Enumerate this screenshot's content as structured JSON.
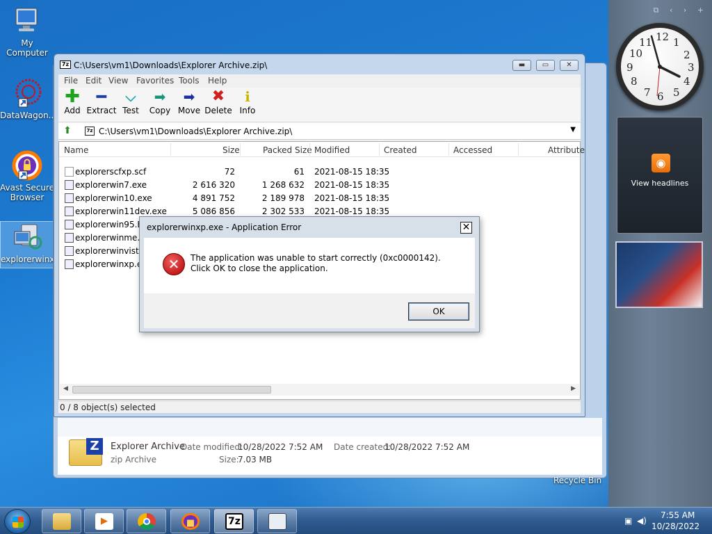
{
  "desktop": {
    "icons": [
      {
        "label": "My Computer"
      },
      {
        "label": "DataWagon..."
      },
      {
        "label": "Avast Secure Browser"
      },
      {
        "label": "explorerwinxp"
      }
    ],
    "recycle_bin": "Recycle Bin"
  },
  "sidebar": {
    "feed_label": "View headlines",
    "clock_numbers": [
      "12",
      "1",
      "2",
      "3",
      "4",
      "5",
      "6",
      "7",
      "8",
      "9",
      "10",
      "11"
    ]
  },
  "window": {
    "title": "C:\\Users\\vm1\\Downloads\\Explorer Archive.zip\\",
    "menu": [
      "File",
      "Edit",
      "View",
      "Favorites",
      "Tools",
      "Help"
    ],
    "toolbar": [
      {
        "label": "Add",
        "icon": "add-icon",
        "color": "#1ea31e"
      },
      {
        "label": "Extract",
        "icon": "extract-icon",
        "color": "#1c3ea8"
      },
      {
        "label": "Test",
        "icon": "test-icon",
        "color": "#17a8a8"
      },
      {
        "label": "Copy",
        "icon": "copy-icon",
        "color": "#15957b"
      },
      {
        "label": "Move",
        "icon": "move-icon",
        "color": "#1c2f98"
      },
      {
        "label": "Delete",
        "icon": "delete-icon",
        "color": "#d11f1f"
      },
      {
        "label": "Info",
        "icon": "info-icon",
        "color": "#c9b400"
      }
    ],
    "address": "C:\\Users\\vm1\\Downloads\\Explorer Archive.zip\\",
    "columns": [
      "Name",
      "Size",
      "Packed Size",
      "Modified",
      "Created",
      "Accessed",
      "Attribute"
    ],
    "rows": [
      {
        "name": "explorerscfxp.scf",
        "size": "72",
        "packed": "61",
        "modified": "2021-08-15 18:35"
      },
      {
        "name": "explorerwin7.exe",
        "size": "2 616 320",
        "packed": "1 268 632",
        "modified": "2021-08-15 18:35"
      },
      {
        "name": "explorerwin10.exe",
        "size": "4 891 752",
        "packed": "2 189 978",
        "modified": "2021-08-15 18:35"
      },
      {
        "name": "explorerwin11dev.exe",
        "size": "5 086 856",
        "packed": "2 302 533",
        "modified": "2021-08-15 18:35"
      },
      {
        "name": "explorerwin95.EXE",
        "size": "",
        "packed": "",
        "modified": ""
      },
      {
        "name": "explorerwinme.EX",
        "size": "",
        "packed": "",
        "modified": ""
      },
      {
        "name": "explorerwinvista.e",
        "size": "",
        "packed": "",
        "modified": ""
      },
      {
        "name": "explorerwinxp.exe",
        "size": "",
        "packed": "",
        "modified": ""
      }
    ],
    "status": "0 / 8 object(s) selected"
  },
  "details": {
    "name": "Explorer Archive",
    "type": "zip Archive",
    "modified_label": "Date modified:",
    "modified": "10/28/2022 7:52 AM",
    "created_label": "Date created:",
    "created": "10/28/2022 7:52 AM",
    "size_label": "Size:",
    "size": "7.03 MB"
  },
  "dialog": {
    "title": "explorerwinxp.exe - Application Error",
    "message": "The application was unable to start correctly (0xc0000142). Click OK to close the application.",
    "ok": "OK"
  },
  "taskbar": {
    "time": "7:55 AM",
    "date": "10/28/2022",
    "zip_label": "7z"
  }
}
